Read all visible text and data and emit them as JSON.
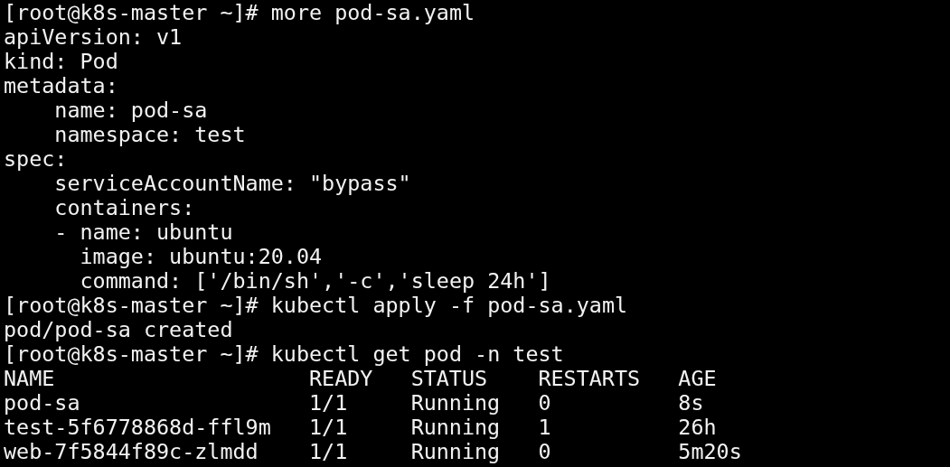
{
  "terminal": [
    {
      "kind": "prompt",
      "prompt": "[root@k8s-master ~]#",
      "command": "more pod-sa.yaml"
    },
    {
      "kind": "output",
      "text": "apiVersion: v1"
    },
    {
      "kind": "output",
      "text": "kind: Pod"
    },
    {
      "kind": "output",
      "text": "metadata:"
    },
    {
      "kind": "output",
      "text": "    name: pod-sa"
    },
    {
      "kind": "output",
      "text": "    namespace: test"
    },
    {
      "kind": "output",
      "text": "spec:"
    },
    {
      "kind": "output",
      "text": "    serviceAccountName: \"bypass\""
    },
    {
      "kind": "output",
      "text": "    containers:"
    },
    {
      "kind": "output",
      "text": "    - name: ubuntu"
    },
    {
      "kind": "output",
      "text": "      image: ubuntu:20.04"
    },
    {
      "kind": "output",
      "text": "      command: ['/bin/sh','-c','sleep 24h']"
    },
    {
      "kind": "prompt",
      "prompt": "[root@k8s-master ~]#",
      "command": "kubectl apply -f pod-sa.yaml"
    },
    {
      "kind": "output",
      "text": "pod/pod-sa created"
    },
    {
      "kind": "prompt",
      "prompt": "[root@k8s-master ~]#",
      "command": "kubectl get pod -n test"
    },
    {
      "kind": "table",
      "columns": [
        "NAME",
        "READY",
        "STATUS",
        "RESTARTS",
        "AGE"
      ],
      "rows": [
        [
          "pod-sa",
          "1/1",
          "Running",
          "0",
          "8s"
        ],
        [
          "test-5f6778868d-ffl9m",
          "1/1",
          "Running",
          "1",
          "26h"
        ],
        [
          "web-7f5844f89c-zlmdd",
          "1/1",
          "Running",
          "0",
          "5m20s"
        ]
      ]
    }
  ]
}
